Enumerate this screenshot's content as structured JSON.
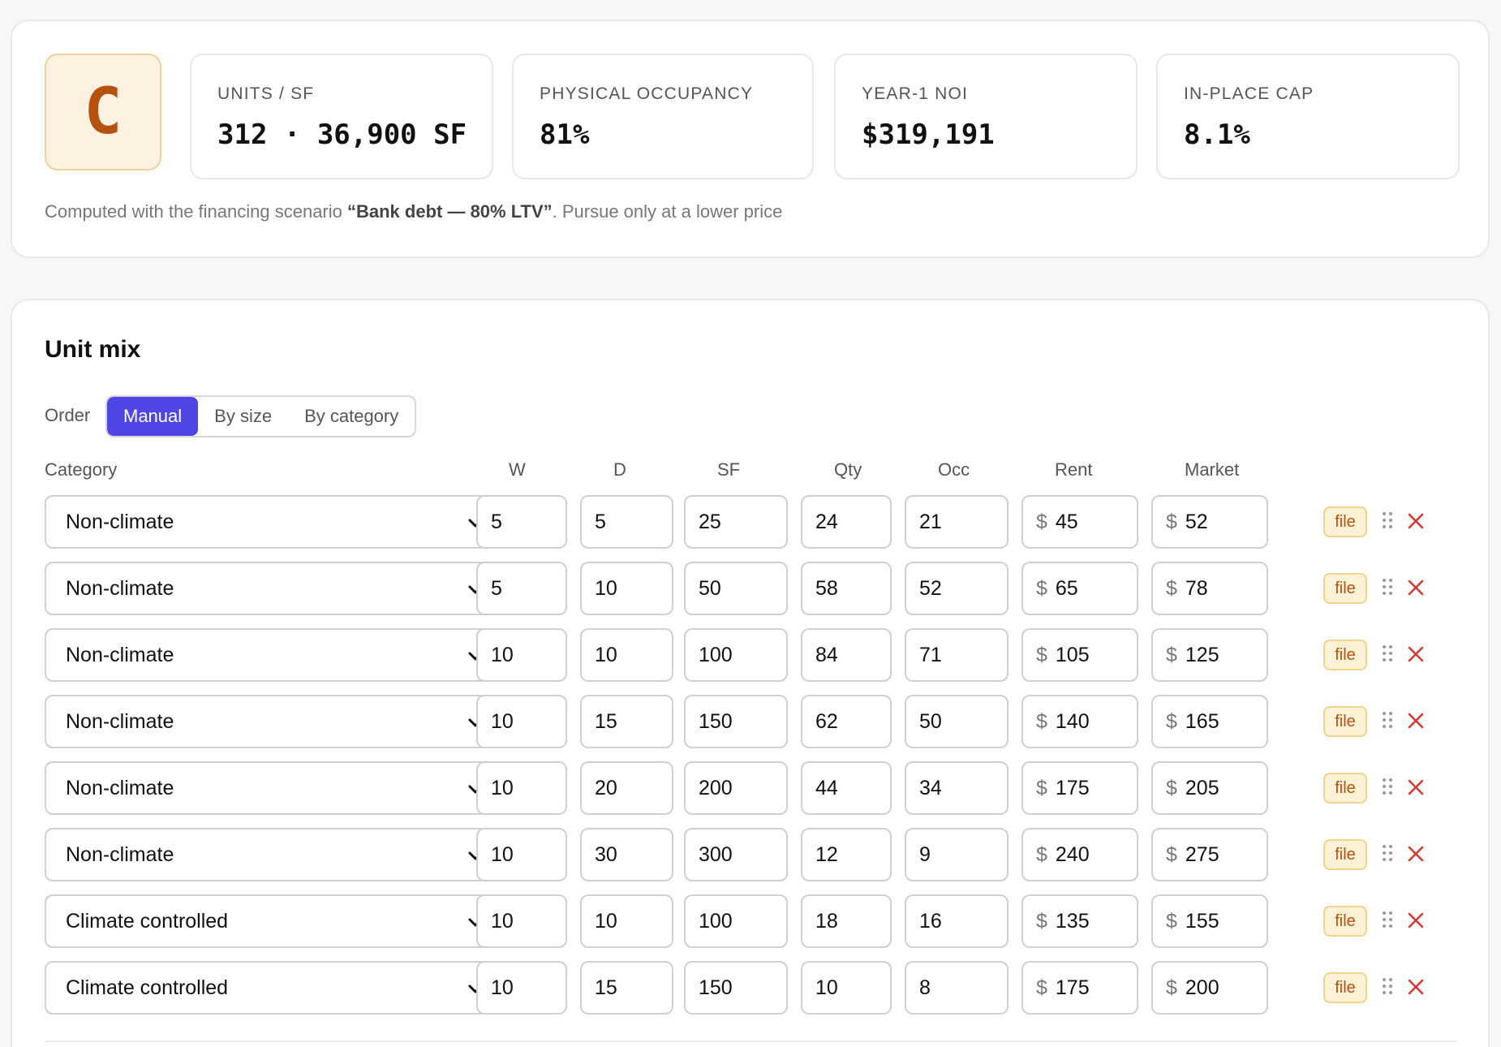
{
  "summary": {
    "grade": "C",
    "stats": [
      {
        "label": "Units / SF",
        "value": "312 · 36,900 SF"
      },
      {
        "label": "Physical occupancy",
        "value": "81%"
      },
      {
        "label": "Year-1 NOI",
        "value": "$319,191"
      },
      {
        "label": "In-place cap",
        "value": "8.1%"
      }
    ],
    "note_prefix": "Computed with the financing scenario ",
    "note_scenario": "“Bank debt — 80% LTV”",
    "note_suffix": ". Pursue only at a lower price"
  },
  "unit_mix": {
    "title": "Unit mix",
    "order_label": "Order",
    "order_options": [
      "Manual",
      "By size",
      "By category"
    ],
    "order_selected": "Manual",
    "columns": {
      "category": "Category",
      "w": "W",
      "d": "D",
      "sf": "SF",
      "qty": "Qty",
      "occ": "Occ",
      "rent": "Rent",
      "market": "Market"
    },
    "currency_symbol": "$",
    "file_label": "file",
    "rows": [
      {
        "category": "Non-climate",
        "w": "5",
        "d": "5",
        "sf": "25",
        "qty": "24",
        "occ": "21",
        "rent": "45",
        "market": "52"
      },
      {
        "category": "Non-climate",
        "w": "5",
        "d": "10",
        "sf": "50",
        "qty": "58",
        "occ": "52",
        "rent": "65",
        "market": "78"
      },
      {
        "category": "Non-climate",
        "w": "10",
        "d": "10",
        "sf": "100",
        "qty": "84",
        "occ": "71",
        "rent": "105",
        "market": "125"
      },
      {
        "category": "Non-climate",
        "w": "10",
        "d": "15",
        "sf": "150",
        "qty": "62",
        "occ": "50",
        "rent": "140",
        "market": "165"
      },
      {
        "category": "Non-climate",
        "w": "10",
        "d": "20",
        "sf": "200",
        "qty": "44",
        "occ": "34",
        "rent": "175",
        "market": "205"
      },
      {
        "category": "Non-climate",
        "w": "10",
        "d": "30",
        "sf": "300",
        "qty": "12",
        "occ": "9",
        "rent": "240",
        "market": "275"
      },
      {
        "category": "Climate controlled",
        "w": "10",
        "d": "10",
        "sf": "100",
        "qty": "18",
        "occ": "16",
        "rent": "135",
        "market": "155"
      },
      {
        "category": "Climate controlled",
        "w": "10",
        "d": "15",
        "sf": "150",
        "qty": "10",
        "occ": "8",
        "rent": "175",
        "market": "200"
      }
    ]
  },
  "colors": {
    "accent": "#4f46e5",
    "grade_text": "#b6520f",
    "grade_bg": "#fdf1e1",
    "danger": "#d43a2f"
  },
  "icons": {
    "dropdown": "chevron-down-icon",
    "drag": "drag-handle-icon",
    "remove": "close-icon"
  }
}
